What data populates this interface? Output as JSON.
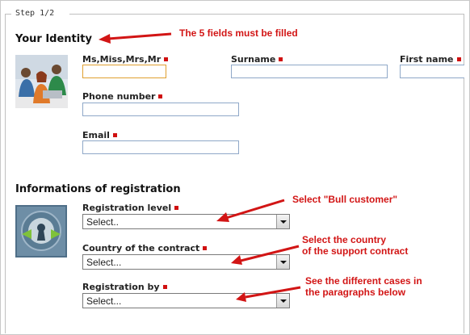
{
  "step": {
    "legend": "Step 1/2"
  },
  "identity": {
    "title": "Your Identity",
    "title_field_label": "Ms,Miss,Mrs,Mr",
    "surname_label": "Surname",
    "firstname_label": "First name",
    "phone_label": "Phone number",
    "email_label": "Email",
    "image_icon": "people-photo-icon"
  },
  "registration": {
    "title": "Informations of registration",
    "level_label": "Registration level",
    "level_value": "Select..",
    "country_label": "Country of the contract",
    "country_value": "Select...",
    "by_label": "Registration by",
    "by_value": "Select...",
    "image_icon": "keyhole-icon"
  },
  "annotations": {
    "fields_note": "The 5 fields must be filled",
    "level_note": "Select \"Bull customer\"",
    "country_note_line1": "Select the country",
    "country_note_line2": "of the support contract",
    "by_note_line1": "See the different cases in",
    "by_note_line2": "the paragraphs below"
  },
  "colors": {
    "annotation": "#d21515",
    "required_marker": "#d01010",
    "input_border": "#8fa8c8",
    "focused_input_border": "#e0a030"
  }
}
